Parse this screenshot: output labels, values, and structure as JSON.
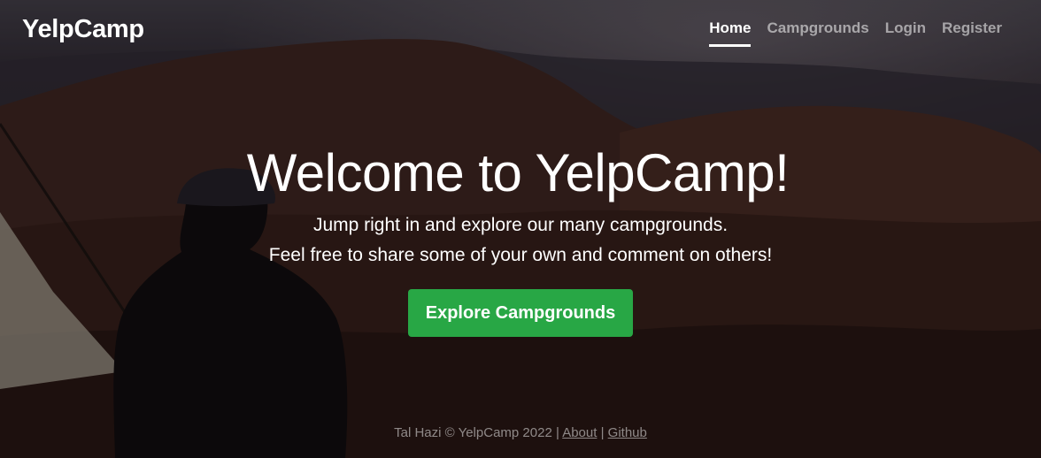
{
  "nav": {
    "brand": "YelpCamp",
    "links": [
      {
        "label": "Home",
        "active": true
      },
      {
        "label": "Campgrounds",
        "active": false
      },
      {
        "label": "Login",
        "active": false
      },
      {
        "label": "Register",
        "active": false
      }
    ]
  },
  "hero": {
    "title": "Welcome to YelpCamp!",
    "lead1": "Jump right in and explore our many campgrounds.",
    "lead2": "Feel free to share some of your own and comment on others!",
    "cta_label": "Explore Campgrounds"
  },
  "footer": {
    "text": "Tal Hazi © YelpCamp 2022 |",
    "separator": "|",
    "about_label": "About",
    "github_label": "Github"
  },
  "colors": {
    "cta": "#28a745",
    "text": "#ffffff"
  }
}
